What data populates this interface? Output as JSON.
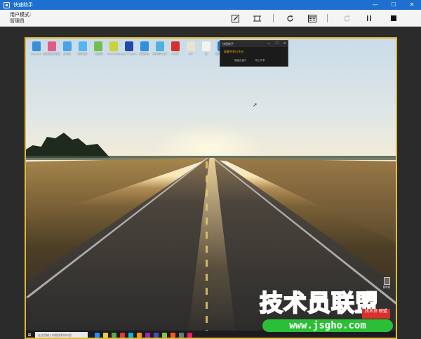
{
  "window": {
    "title": "快速助手",
    "controls": {
      "minimize": "—",
      "maximize": "☐",
      "close": "✕"
    }
  },
  "toolbar": {
    "user_mode_label": "用户模式:",
    "user_mode_value": "管理员",
    "tools": [
      {
        "name": "annotate-icon"
      },
      {
        "name": "fit-screen-icon"
      },
      {
        "name": "restart-icon"
      },
      {
        "name": "task-manager-icon"
      },
      {
        "name": "reconnect-icon",
        "disabled": true
      },
      {
        "name": "pause-icon"
      },
      {
        "name": "stop-icon"
      }
    ]
  },
  "remote": {
    "desktop_icons": [
      {
        "label": "Emerald",
        "color": "#3a8fd8"
      },
      {
        "label": "百度网盘下载器",
        "color": "#e25a8a"
      },
      {
        "label": "此电脑",
        "color": "#4aa3e8"
      },
      {
        "label": "控制面板",
        "color": "#55b6ef"
      },
      {
        "label": "一键重装",
        "color": "#6fbf4c"
      },
      {
        "label": "Fireworks",
        "color": "#c8d43a"
      },
      {
        "label": "Adobe Photosh...",
        "color": "#1f4aa8"
      },
      {
        "label": "高级系统",
        "color": "#2e8ee0"
      },
      {
        "label": "系统自带工具",
        "color": "#52b0e0"
      },
      {
        "label": "IT之家",
        "color": "#d8302c"
      },
      {
        "label": "vbk",
        "color": "#e6e6d0"
      },
      {
        "label": "迅",
        "color": "#f2f2f2"
      },
      {
        "label": "迅雷极速版",
        "color": "#2877d0"
      }
    ],
    "mini_window": {
      "title": "快速助手",
      "message": "屏幕共享已开启",
      "links": [
        "隐藏此窗口",
        "停止共享"
      ]
    },
    "recycle_bin_label": "回收站",
    "taskbar": {
      "search_placeholder": "在这里输入你要搜索的内容",
      "app_colors": [
        "#1e90ff",
        "#f5c542",
        "#4caf50",
        "#e53935",
        "#00bcd4",
        "#ff9800",
        "#9c27b0",
        "#3f51b5",
        "#8bc34a",
        "#ff5722",
        "#607d8b",
        "#e91e63"
      ]
    }
  },
  "watermark": {
    "text": "技术员联盟",
    "url": "www.jsgho.com",
    "stamp": "技术员 联盟"
  },
  "colors": {
    "titlebar": "#1f6fd0",
    "frame_border": "#e2b93a",
    "watermark_green": "#2bbf37"
  }
}
